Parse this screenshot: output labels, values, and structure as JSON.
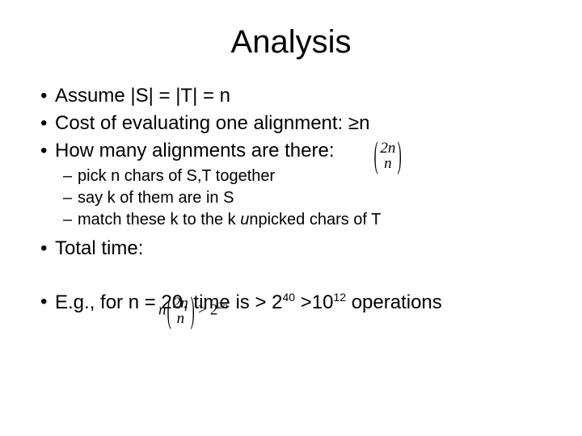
{
  "title": "Analysis",
  "bullets": {
    "b1": "Assume |S| = |T| = n",
    "b2": "Cost of evaluating one alignment: ≥n",
    "b3": "How many alignments are there:",
    "sub1": "pick n chars of S,T together",
    "sub2": "say k of them are in S",
    "sub3_prefix": "match these k to the k ",
    "sub3_ital": "u",
    "sub3_suffix": "npicked chars of T",
    "b4": "Total time:",
    "b5_prefix": "E.g., for n = 20, time is > 2",
    "b5_sup1": "40",
    "b5_mid": " >10",
    "b5_sup2": "12",
    "b5_suffix": " operations"
  },
  "formula1": {
    "top": "2n",
    "bottom": "n"
  },
  "formula2": {
    "n": "n",
    "top": "2n",
    "bottom": "n",
    "gt": ">",
    "base": "2",
    "exp_coef": "2",
    "exp_var": "n"
  }
}
